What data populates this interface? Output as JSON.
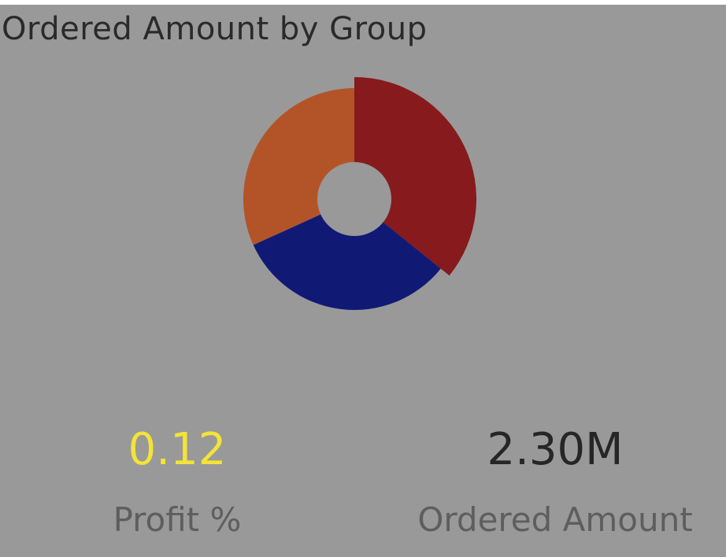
{
  "chart_data": {
    "type": "pie",
    "title": "Ordered Amount by Group",
    "donut": true,
    "slices": [
      {
        "share": 0.358,
        "color": "#861a1d"
      },
      {
        "share": 0.324,
        "color": "#101a75"
      },
      {
        "share": 0.318,
        "color": "#b35428"
      }
    ]
  },
  "cards": [
    {
      "value": "0.12",
      "label": "Profit %",
      "value_color": "#f3e33a"
    },
    {
      "value": "2.30M",
      "label": "Ordered Amount",
      "value_color": "#262626"
    }
  ],
  "colors": {
    "background": "#999999",
    "title": "#2a2a2a",
    "label": "#5e5e5e"
  }
}
